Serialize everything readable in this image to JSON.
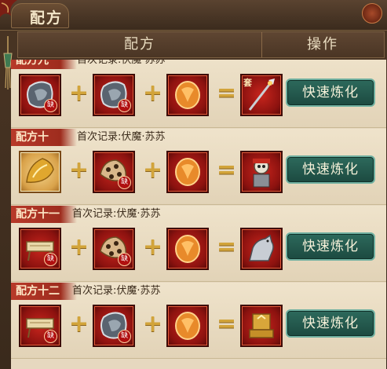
{
  "window": {
    "title": "配方",
    "close_icon": "close-icon",
    "accent": "#b83a2a"
  },
  "header": {
    "recipe_col": "配方",
    "action_col": "操作"
  },
  "symbols": {
    "plus": "+",
    "equals": "=",
    "missing": "缺",
    "set": "套"
  },
  "rows": [
    {
      "name": "配方九",
      "record": "首次记录:伏魔·苏苏",
      "ingredients": [
        {
          "icon": "stone-shard-icon",
          "missing": true
        },
        {
          "icon": "stone-shard-icon",
          "missing": true
        },
        {
          "icon": "orange-crystal-icon",
          "missing": false
        }
      ],
      "result": {
        "icon": "staff-weapon-icon",
        "set": true
      },
      "action": "快速炼化"
    },
    {
      "name": "配方十",
      "record": "首次记录:伏魔·苏苏",
      "ingredients": [
        {
          "icon": "gold-hide-icon",
          "missing": false
        },
        {
          "icon": "leopard-pelt-icon",
          "missing": true
        },
        {
          "icon": "orange-crystal-icon",
          "missing": false
        }
      ],
      "result": {
        "icon": "skeleton-warrior-icon",
        "set": false
      },
      "action": "快速炼化"
    },
    {
      "name": "配方十一",
      "record": "首次记录:伏魔·苏苏",
      "ingredients": [
        {
          "icon": "scroll-table-icon",
          "missing": true
        },
        {
          "icon": "leopard-pelt-icon",
          "missing": true
        },
        {
          "icon": "orange-crystal-icon",
          "missing": false
        }
      ],
      "result": {
        "icon": "armored-horse-icon",
        "set": false
      },
      "action": "快速炼化"
    },
    {
      "name": "配方十二",
      "record": "首次记录:伏魔·苏苏",
      "ingredients": [
        {
          "icon": "scroll-table-icon",
          "missing": true
        },
        {
          "icon": "stone-shard-icon",
          "missing": true
        },
        {
          "icon": "orange-crystal-icon",
          "missing": false
        }
      ],
      "result": {
        "icon": "golden-throne-icon",
        "set": false
      },
      "action": "快速炼化"
    }
  ]
}
